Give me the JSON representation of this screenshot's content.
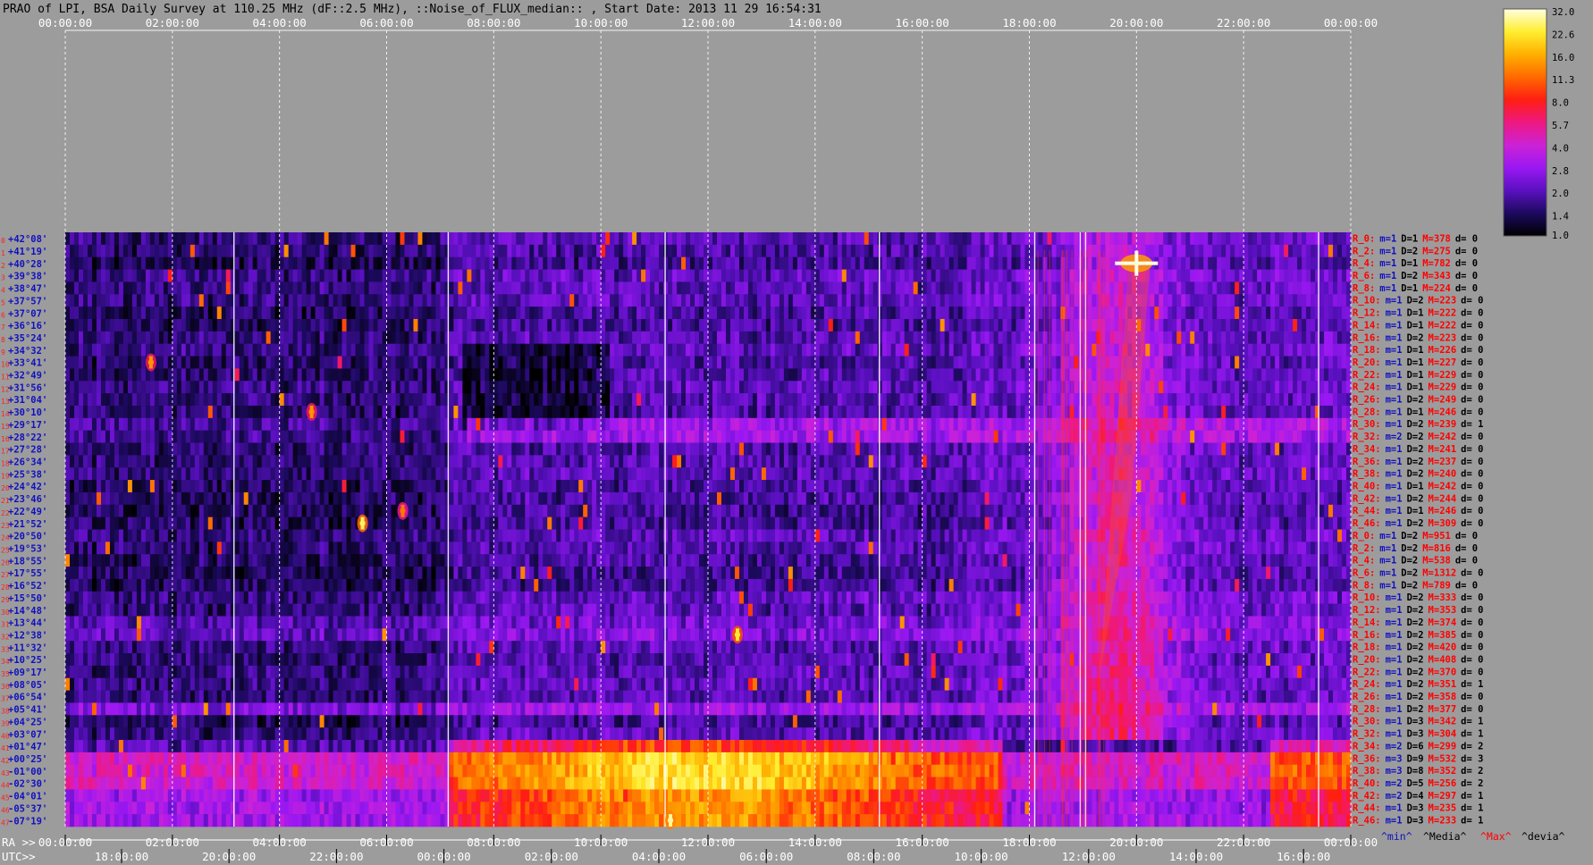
{
  "chart_data": {
    "type": "heatmap",
    "title": "PRAO of LPI, BSA Daily Survey at 110.25 MHz (dF::2.5 MHz), ::Noise_of_FLUX_median:: , Start Date: 2013 11 29 16:54:31",
    "colorbar": {
      "ticks": [
        "32.0",
        "22.6",
        "16.0",
        "11.3",
        "8.0",
        "5.7",
        "4.0",
        "2.8",
        "2.0",
        "1.4",
        "1.0"
      ],
      "range": [
        1.0,
        32.0
      ],
      "scale": "log",
      "colors": [
        "#000000",
        "#1c0a5e",
        "#5a10c0",
        "#9a18f2",
        "#cc22d6",
        "#ee1880",
        "#ff1e12",
        "#ff6a00",
        "#ffb000",
        "#ffee30",
        "#ffffe0"
      ]
    },
    "top_axis": {
      "ticks": [
        "00:00:00",
        "02:00:00",
        "04:00:00",
        "06:00:00",
        "08:00:00",
        "10:00:00",
        "12:00:00",
        "14:00:00",
        "16:00:00",
        "18:00:00",
        "20:00:00",
        "22:00:00",
        "00:00:00"
      ]
    },
    "bottom_axis": {
      "ra_prefix": "RA >>",
      "utc_prefix": "UTC>>",
      "ra_ticks": [
        "00:00:00",
        "02:00:00",
        "04:00:00",
        "06:00:00",
        "08:00:00",
        "10:00:00",
        "12:00:00",
        "14:00:00",
        "16:00:00",
        "18:00:00",
        "20:00:00",
        "22:00:00",
        "00:00:00"
      ],
      "utc_ticks": [
        "18:00:00",
        "20:00:00",
        "22:00:00",
        "00:00:00",
        "02:00:00",
        "04:00:00",
        "06:00:00",
        "08:00:00",
        "10:00:00",
        "12:00:00",
        "14:00:00",
        "16:00:00"
      ]
    },
    "y_axis": {
      "beam_numbers": [
        "0",
        "1",
        "2",
        "3",
        "4",
        "5",
        "6",
        "7",
        "8",
        "9",
        "10",
        "11",
        "12",
        "13",
        "14",
        "15",
        "16",
        "17",
        "18",
        "19",
        "20",
        "21",
        "22",
        "23",
        "24",
        "25",
        "26",
        "27",
        "28",
        "29",
        "30",
        "31",
        "32",
        "33",
        "34",
        "35",
        "36",
        "37",
        "38",
        "39",
        "40",
        "41",
        "42",
        "43",
        "44",
        "45",
        "46",
        "47",
        "0",
        "1",
        "2",
        "3",
        "4",
        "5",
        "6",
        "7",
        "8",
        "9",
        "10",
        "11",
        "12",
        "13",
        "14",
        "15",
        "16",
        "17",
        "18",
        "19",
        "20",
        "21",
        "22",
        "23",
        "24",
        "25",
        "26",
        "27",
        "28",
        "29",
        "30",
        "31",
        "32",
        "33",
        "34",
        "35",
        "36",
        "37",
        "38",
        "39",
        "40",
        "41",
        "42",
        "43",
        "44",
        "45",
        "46",
        "47"
      ],
      "declinations": [
        "+42°08'",
        "+41°19'",
        "+40°28'",
        "+39°38'",
        "+38°47'",
        "+37°57'",
        "+37°07'",
        "+36°16'",
        "+35°24'",
        "+34°32'",
        "+33°41'",
        "+32°49'",
        "+31°56'",
        "+31°04'",
        "+30°10'",
        "+29°17'",
        "+28°22'",
        "+27°28'",
        "+26°34'",
        "+25°38'",
        "+24°42'",
        "+23°46'",
        "+22°49'",
        "+21°52'",
        "+20°50'",
        "+19°53'",
        "+18°55'",
        "+17°55'",
        "+16°52'",
        "+15°50'",
        "+14°48'",
        "+13°44'",
        "+12°38'",
        "+11°32'",
        "+10°25'",
        "+09°17'",
        "+08°05'",
        "+06°54'",
        "+05°41'",
        "+04°25'",
        "+03°07'",
        "+01°47'",
        "+00°25'",
        "-01°00'",
        "-02°30'",
        "-04°01'",
        "-05°37'",
        "-07°19'"
      ]
    },
    "right_stats": [
      {
        "r": "R_0:",
        "m": "m=1",
        "d": "D=1",
        "mm": "M=378",
        "dd": "d= 0"
      },
      {
        "r": "R_2:",
        "m": "m=1",
        "d": "D=2",
        "mm": "M=275",
        "dd": "d= 0"
      },
      {
        "r": "R_4:",
        "m": "m=1",
        "d": "D=1",
        "mm": "M=782",
        "dd": "d= 0"
      },
      {
        "r": "R_6:",
        "m": "m=1",
        "d": "D=2",
        "mm": "M=343",
        "dd": "d= 0"
      },
      {
        "r": "R_8:",
        "m": "m=1",
        "d": "D=1",
        "mm": "M=224",
        "dd": "d= 0"
      },
      {
        "r": "R_10:",
        "m": "m=1",
        "d": "D=2",
        "mm": "M=223",
        "dd": "d= 0"
      },
      {
        "r": "R_12:",
        "m": "m=1",
        "d": "D=1",
        "mm": "M=222",
        "dd": "d= 0"
      },
      {
        "r": "R_14:",
        "m": "m=1",
        "d": "D=1",
        "mm": "M=222",
        "dd": "d= 0"
      },
      {
        "r": "R_16:",
        "m": "m=1",
        "d": "D=2",
        "mm": "M=223",
        "dd": "d= 0"
      },
      {
        "r": "R_18:",
        "m": "m=1",
        "d": "D=1",
        "mm": "M=226",
        "dd": "d= 0"
      },
      {
        "r": "R_20:",
        "m": "m=1",
        "d": "D=1",
        "mm": "M=227",
        "dd": "d= 0"
      },
      {
        "r": "R_22:",
        "m": "m=1",
        "d": "D=1",
        "mm": "M=229",
        "dd": "d= 0"
      },
      {
        "r": "R_24:",
        "m": "m=1",
        "d": "D=1",
        "mm": "M=229",
        "dd": "d= 0"
      },
      {
        "r": "R_26:",
        "m": "m=1",
        "d": "D=2",
        "mm": "M=249",
        "dd": "d= 0"
      },
      {
        "r": "R_28:",
        "m": "m=1",
        "d": "D=1",
        "mm": "M=246",
        "dd": "d= 0"
      },
      {
        "r": "R_30:",
        "m": "m=1",
        "d": "D=2",
        "mm": "M=239",
        "dd": "d= 1"
      },
      {
        "r": "R_32:",
        "m": "m=2",
        "d": "D=2",
        "mm": "M=242",
        "dd": "d= 0"
      },
      {
        "r": "R_34:",
        "m": "m=1",
        "d": "D=2",
        "mm": "M=241",
        "dd": "d= 0"
      },
      {
        "r": "R_36:",
        "m": "m=1",
        "d": "D=2",
        "mm": "M=237",
        "dd": "d= 0"
      },
      {
        "r": "R_38:",
        "m": "m=1",
        "d": "D=2",
        "mm": "M=240",
        "dd": "d= 0"
      },
      {
        "r": "R_40:",
        "m": "m=1",
        "d": "D=1",
        "mm": "M=242",
        "dd": "d= 0"
      },
      {
        "r": "R_42:",
        "m": "m=1",
        "d": "D=2",
        "mm": "M=244",
        "dd": "d= 0"
      },
      {
        "r": "R_44:",
        "m": "m=1",
        "d": "D=1",
        "mm": "M=246",
        "dd": "d= 0"
      },
      {
        "r": "R_46:",
        "m": "m=1",
        "d": "D=2",
        "mm": "M=309",
        "dd": "d= 0"
      },
      {
        "r": "R_0:",
        "m": "m=1",
        "d": "D=2",
        "mm": "M=951",
        "dd": "d= 0"
      },
      {
        "r": "R_2:",
        "m": "m=1",
        "d": "D=2",
        "mm": "M=816",
        "dd": "d= 0"
      },
      {
        "r": "R_4:",
        "m": "m=1",
        "d": "D=2",
        "mm": "M=538",
        "dd": "d= 0"
      },
      {
        "r": "R_6:",
        "m": "m=1",
        "d": "D=2",
        "mm": "M=1312",
        "dd": "d= 0"
      },
      {
        "r": "R_8:",
        "m": "m=1",
        "d": "D=2",
        "mm": "M=789",
        "dd": "d= 0"
      },
      {
        "r": "R_10:",
        "m": "m=1",
        "d": "D=2",
        "mm": "M=333",
        "dd": "d= 0"
      },
      {
        "r": "R_12:",
        "m": "m=1",
        "d": "D=2",
        "mm": "M=353",
        "dd": "d= 0"
      },
      {
        "r": "R_14:",
        "m": "m=1",
        "d": "D=2",
        "mm": "M=374",
        "dd": "d= 0"
      },
      {
        "r": "R_16:",
        "m": "m=1",
        "d": "D=2",
        "mm": "M=385",
        "dd": "d= 0"
      },
      {
        "r": "R_18:",
        "m": "m=1",
        "d": "D=2",
        "mm": "M=420",
        "dd": "d= 0"
      },
      {
        "r": "R_20:",
        "m": "m=1",
        "d": "D=2",
        "mm": "M=408",
        "dd": "d= 0"
      },
      {
        "r": "R_22:",
        "m": "m=1",
        "d": "D=2",
        "mm": "M=370",
        "dd": "d= 0"
      },
      {
        "r": "R_24:",
        "m": "m=1",
        "d": "D=2",
        "mm": "M=351",
        "dd": "d= 1"
      },
      {
        "r": "R_26:",
        "m": "m=1",
        "d": "D=2",
        "mm": "M=358",
        "dd": "d= 0"
      },
      {
        "r": "R_28:",
        "m": "m=1",
        "d": "D=2",
        "mm": "M=377",
        "dd": "d= 0"
      },
      {
        "r": "R_30:",
        "m": "m=1",
        "d": "D=3",
        "mm": "M=342",
        "dd": "d= 1"
      },
      {
        "r": "R_32:",
        "m": "m=1",
        "d": "D=3",
        "mm": "M=304",
        "dd": "d= 1"
      },
      {
        "r": "R_34:",
        "m": "m=2",
        "d": "D=6",
        "mm": "M=299",
        "dd": "d= 2"
      },
      {
        "r": "R_36:",
        "m": "m=3",
        "d": "D=9",
        "mm": "M=532",
        "dd": "d= 3"
      },
      {
        "r": "R_38:",
        "m": "m=3",
        "d": "D=8",
        "mm": "M=352",
        "dd": "d= 2"
      },
      {
        "r": "R_40:",
        "m": "m=2",
        "d": "D=5",
        "mm": "M=256",
        "dd": "d= 2"
      },
      {
        "r": "R_42:",
        "m": "m=2",
        "d": "D=4",
        "mm": "M=297",
        "dd": "d= 1"
      },
      {
        "r": "R_44:",
        "m": "m=1",
        "d": "D=3",
        "mm": "M=235",
        "dd": "d= 1"
      },
      {
        "r": "R_46:",
        "m": "m=1",
        "d": "D=3",
        "mm": "M=233",
        "dd": "d= 1"
      }
    ],
    "legend": [
      "^min^",
      "^Media^",
      "^Max^",
      "^devia^"
    ],
    "legend_colors": [
      "#1010c0",
      "#000000",
      "#ff0000",
      "#000000"
    ],
    "stat_colors": {
      "r": "#ff0000",
      "m": "#1010c0",
      "d": "#000000",
      "mm": "#ff0000",
      "dd": "#000000"
    },
    "features": {
      "strong_band_rows": [
        41,
        47
      ],
      "bright_sources": [
        {
          "ra_h": 20.0,
          "row": 2,
          "v": 32.0
        },
        {
          "ra_h": 5.55,
          "row": 23,
          "v": 25.0
        },
        {
          "ra_h": 12.55,
          "row": 32,
          "v": 22.0
        },
        {
          "ra_h": 11.3,
          "row": 47,
          "v": 28.0
        },
        {
          "ra_h": 1.6,
          "row": 10,
          "v": 14.0
        },
        {
          "ra_h": 4.6,
          "row": 14,
          "v": 14.0
        },
        {
          "ra_h": 6.3,
          "row": 22,
          "v": 12.0
        }
      ]
    }
  }
}
